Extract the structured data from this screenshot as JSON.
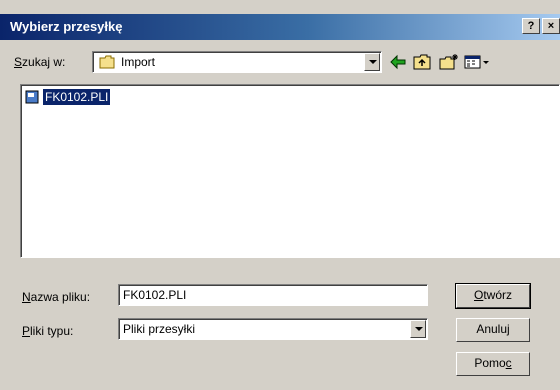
{
  "window": {
    "title": "Wybierz przesyłkę",
    "help_button": "?",
    "close_button": "×"
  },
  "lookin": {
    "label": "Szukaj w:",
    "value": "Import",
    "toolbar": [
      "back-icon",
      "up-folder-icon",
      "new-folder-icon",
      "view-menu-icon"
    ]
  },
  "files": [
    {
      "name": "FK0102.PLI",
      "selected": true
    }
  ],
  "filename": {
    "label": "Nazwa pliku:",
    "value": "FK0102.PLI"
  },
  "filetype": {
    "label": "Pliki typu:",
    "value": "Pliki przesyłki"
  },
  "buttons": {
    "open": "Otwórz",
    "cancel": "Anuluj",
    "help": "Pomoc"
  }
}
